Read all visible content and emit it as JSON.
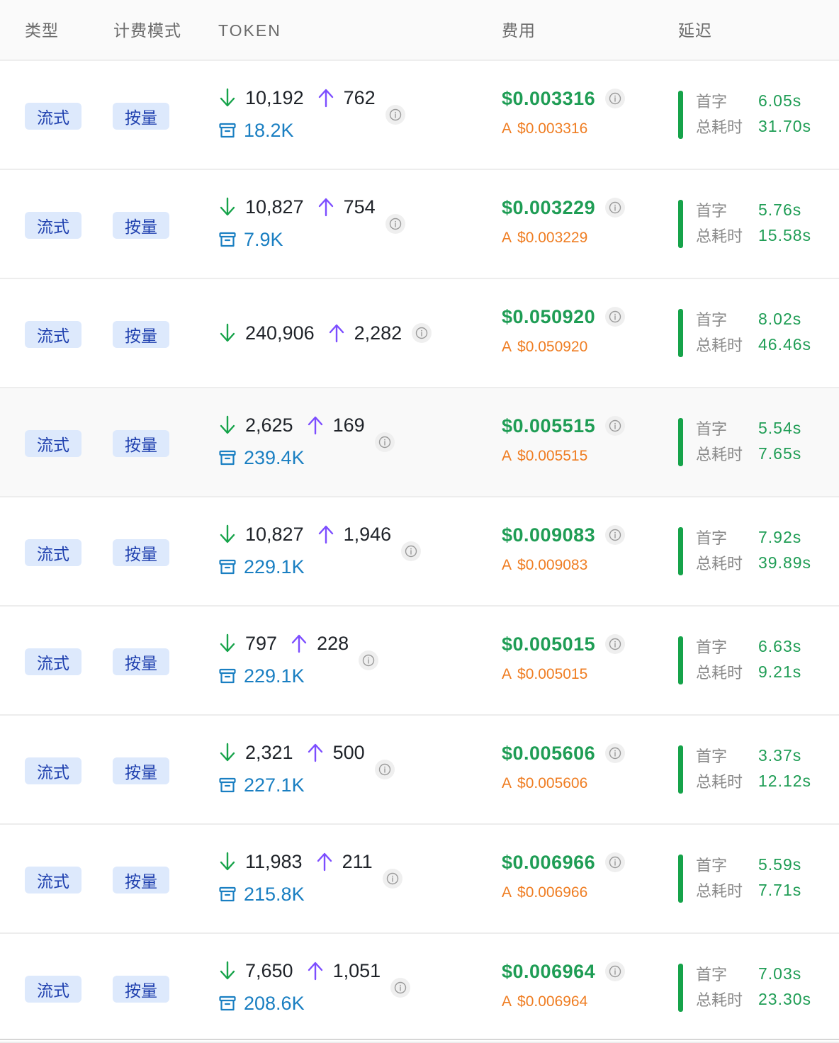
{
  "header": {
    "type": "类型",
    "billing_mode": "计费模式",
    "token": "TOKEN",
    "cost": "费用",
    "latency": "延迟"
  },
  "colors": {
    "tag_bg": "#dde9fc",
    "tag_text": "#1e3fae",
    "cost_green": "#1f9d55",
    "cost_orange": "#ef7d22",
    "cache_blue": "#1a7fc2",
    "input_arrow_green": "#16a34a",
    "output_arrow_purple": "#7c4dff"
  },
  "icons": {
    "input": "arrow-down-icon",
    "output": "arrow-up-icon",
    "cache": "archive-box-icon",
    "info": "info-circle-icon"
  },
  "latency_labels": {
    "first": "首字",
    "total": "总耗时"
  },
  "cost_prefix": "A",
  "rows": [
    {
      "type": "流式",
      "mode": "按量",
      "input": "10,192",
      "output": "762",
      "cache": "18.2K",
      "cost": "$0.003316",
      "cost_sub": "$0.003316",
      "first": "6.05s",
      "total": "31.70s"
    },
    {
      "type": "流式",
      "mode": "按量",
      "input": "10,827",
      "output": "754",
      "cache": "7.9K",
      "cost": "$0.003229",
      "cost_sub": "$0.003229",
      "first": "5.76s",
      "total": "15.58s"
    },
    {
      "type": "流式",
      "mode": "按量",
      "input": "240,906",
      "output": "2,282",
      "cache": "",
      "cost": "$0.050920",
      "cost_sub": "$0.050920",
      "first": "8.02s",
      "total": "46.46s"
    },
    {
      "type": "流式",
      "mode": "按量",
      "input": "2,625",
      "output": "169",
      "cache": "239.4K",
      "cost": "$0.005515",
      "cost_sub": "$0.005515",
      "first": "5.54s",
      "total": "7.65s"
    },
    {
      "type": "流式",
      "mode": "按量",
      "input": "10,827",
      "output": "1,946",
      "cache": "229.1K",
      "cost": "$0.009083",
      "cost_sub": "$0.009083",
      "first": "7.92s",
      "total": "39.89s"
    },
    {
      "type": "流式",
      "mode": "按量",
      "input": "797",
      "output": "228",
      "cache": "229.1K",
      "cost": "$0.005015",
      "cost_sub": "$0.005015",
      "first": "6.63s",
      "total": "9.21s"
    },
    {
      "type": "流式",
      "mode": "按量",
      "input": "2,321",
      "output": "500",
      "cache": "227.1K",
      "cost": "$0.005606",
      "cost_sub": "$0.005606",
      "first": "3.37s",
      "total": "12.12s"
    },
    {
      "type": "流式",
      "mode": "按量",
      "input": "11,983",
      "output": "211",
      "cache": "215.8K",
      "cost": "$0.006966",
      "cost_sub": "$0.006966",
      "first": "5.59s",
      "total": "7.71s"
    },
    {
      "type": "流式",
      "mode": "按量",
      "input": "7,650",
      "output": "1,051",
      "cache": "208.6K",
      "cost": "$0.006964",
      "cost_sub": "$0.006964",
      "first": "7.03s",
      "total": "23.30s"
    }
  ]
}
